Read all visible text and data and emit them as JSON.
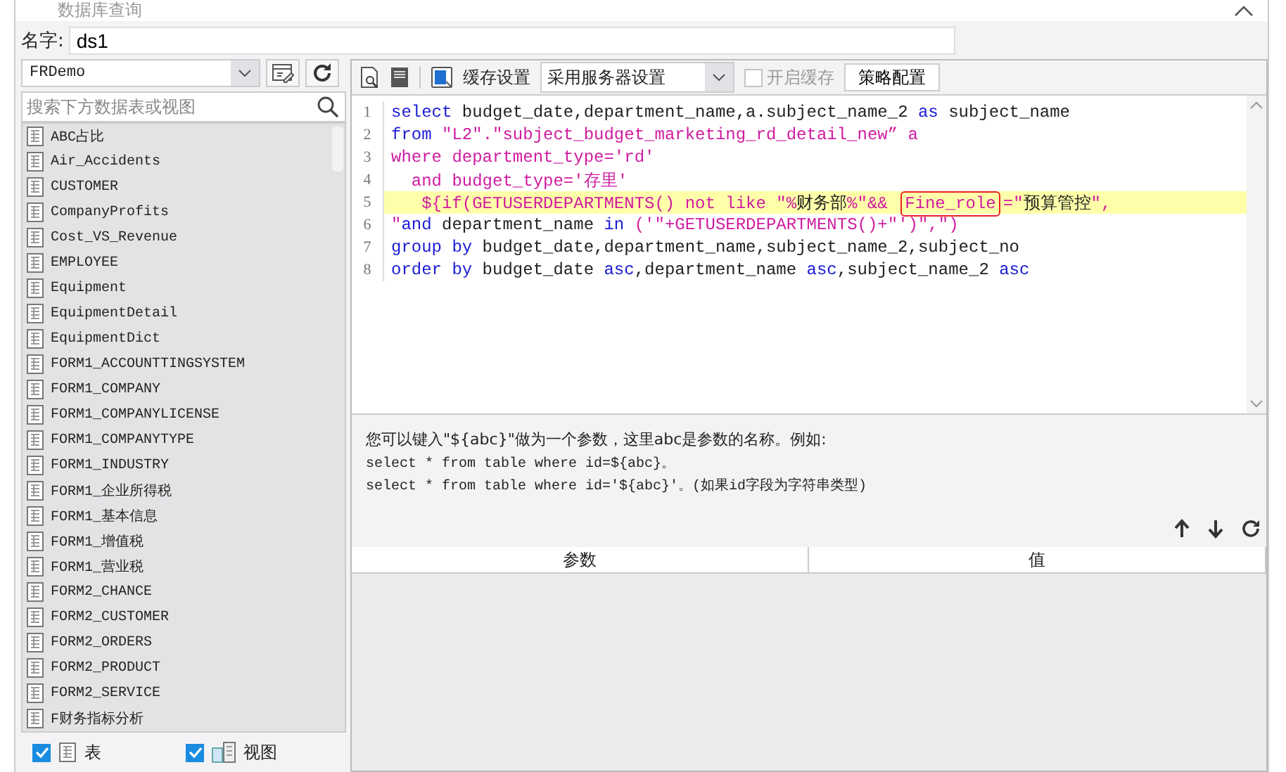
{
  "window": {
    "title": "数据库查询"
  },
  "name_field": {
    "label": "名字:",
    "value": "ds1"
  },
  "connection": {
    "value": "FRDemo"
  },
  "search": {
    "placeholder": "搜索下方数据表或视图"
  },
  "tables": [
    "ABC占比",
    "Air_Accidents",
    "CUSTOMER",
    "CompanyProfits",
    "Cost_VS_Revenue",
    "EMPLOYEE",
    "Equipment",
    "EquipmentDetail",
    "EquipmentDict",
    "FORM1_ACCOUNTTINGSYSTEM",
    "FORM1_COMPANY",
    "FORM1_COMPANYLICENSE",
    "FORM1_COMPANYTYPE",
    "FORM1_INDUSTRY",
    "FORM1_企业所得税",
    "FORM1_基本信息",
    "FORM1_增值税",
    "FORM1_营业税",
    "FORM2_CHANCE",
    "FORM2_CUSTOMER",
    "FORM2_ORDERS",
    "FORM2_PRODUCT",
    "FORM2_SERVICE",
    "F财务指标分析"
  ],
  "filters": [
    {
      "label": "表",
      "checked": true,
      "kind": "table"
    },
    {
      "label": "视图",
      "checked": true,
      "kind": "view"
    }
  ],
  "toolbar": {
    "cache_label": "缓存设置",
    "cache_mode": "采用服务器设置",
    "enable_cache": {
      "label": "开启缓存",
      "checked": false,
      "disabled": true
    },
    "strategy_button": "策略配置"
  },
  "code_lines": [
    {
      "number": "1",
      "highlighted": false,
      "tokens": [
        {
          "kind": "keyword",
          "text": "select"
        },
        {
          "kind": "plain",
          "text": " budget_date,department_name,a.subject_name_2 "
        },
        {
          "kind": "keyword",
          "text": "as"
        },
        {
          "kind": "plain",
          "text": " subject_name"
        }
      ]
    },
    {
      "number": "2",
      "highlighted": false,
      "tokens": [
        {
          "kind": "keyword",
          "text": "from"
        },
        {
          "kind": "string",
          "text": " \"L2\".\"subject_budget_marketing_rd_detail_new” a"
        }
      ]
    },
    {
      "number": "3",
      "highlighted": false,
      "tokens": [
        {
          "kind": "string",
          "text": "where department_type='rd'"
        }
      ]
    },
    {
      "number": "4",
      "highlighted": false,
      "tokens": [
        {
          "kind": "string",
          "text": "  and budget_type='存里'"
        }
      ]
    },
    {
      "number": "5",
      "highlighted": true,
      "tokens": [
        {
          "kind": "string",
          "text": "   ${if(GETUSERDEPARTMENTS() not like \"%"
        },
        {
          "kind": "plain",
          "text": "财务部"
        },
        {
          "kind": "string",
          "text": "%\"&& "
        },
        {
          "kind": "string",
          "text": "Fine_role",
          "circled": true
        },
        {
          "kind": "string",
          "text": "=\""
        },
        {
          "kind": "plain",
          "text": "预算管控"
        },
        {
          "kind": "string",
          "text": "\","
        }
      ]
    },
    {
      "number": "6",
      "highlighted": false,
      "tokens": [
        {
          "kind": "string",
          "text": "\""
        },
        {
          "kind": "keyword",
          "text": "and"
        },
        {
          "kind": "plain",
          "text": " department_name "
        },
        {
          "kind": "keyword",
          "text": "in"
        },
        {
          "kind": "string",
          "text": " ('\"+GETUSERDEPARTMENTS()+\"')\",\")"
        }
      ]
    },
    {
      "number": "7",
      "highlighted": false,
      "tokens": [
        {
          "kind": "keyword",
          "text": "group by"
        },
        {
          "kind": "plain",
          "text": " budget_date,department_name,subject_name_2,subject_no"
        }
      ]
    },
    {
      "number": "8",
      "highlighted": false,
      "tokens": [
        {
          "kind": "keyword",
          "text": "order by"
        },
        {
          "kind": "plain",
          "text": " budget_date "
        },
        {
          "kind": "keyword",
          "text": "asc"
        },
        {
          "kind": "plain",
          "text": ",department_name "
        },
        {
          "kind": "keyword",
          "text": "asc"
        },
        {
          "kind": "plain",
          "text": ",subject_name_2 "
        },
        {
          "kind": "keyword",
          "text": "asc"
        }
      ]
    }
  ],
  "hint": [
    "您可以键入\"${abc}\"做为一个参数，这里abc是参数的名称。例如:",
    "select * from table where id=${abc}。",
    "select * from table where id='${abc}'。(如果id字段为字符串类型)"
  ],
  "params_table": {
    "columns": [
      "参数",
      "值"
    ]
  }
}
